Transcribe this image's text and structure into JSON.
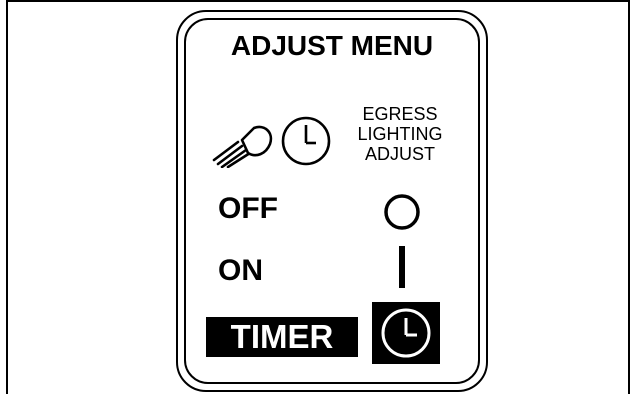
{
  "panel": {
    "title": "ADJUST MENU",
    "icons": {
      "headlight": "headlight-icon",
      "clock": "clock-icon"
    },
    "egress_label_lines": [
      "EGRESS",
      "LIGHTING",
      "ADJUST"
    ],
    "rows": [
      {
        "label": "OFF",
        "symbol": "circle-icon"
      },
      {
        "label": "ON",
        "symbol": "vertical-bar-icon"
      },
      {
        "label": "TIMER",
        "symbol": "clock-icon",
        "highlighted": true
      }
    ]
  },
  "colors": {
    "foreground": "#000000",
    "background": "#ffffff"
  }
}
